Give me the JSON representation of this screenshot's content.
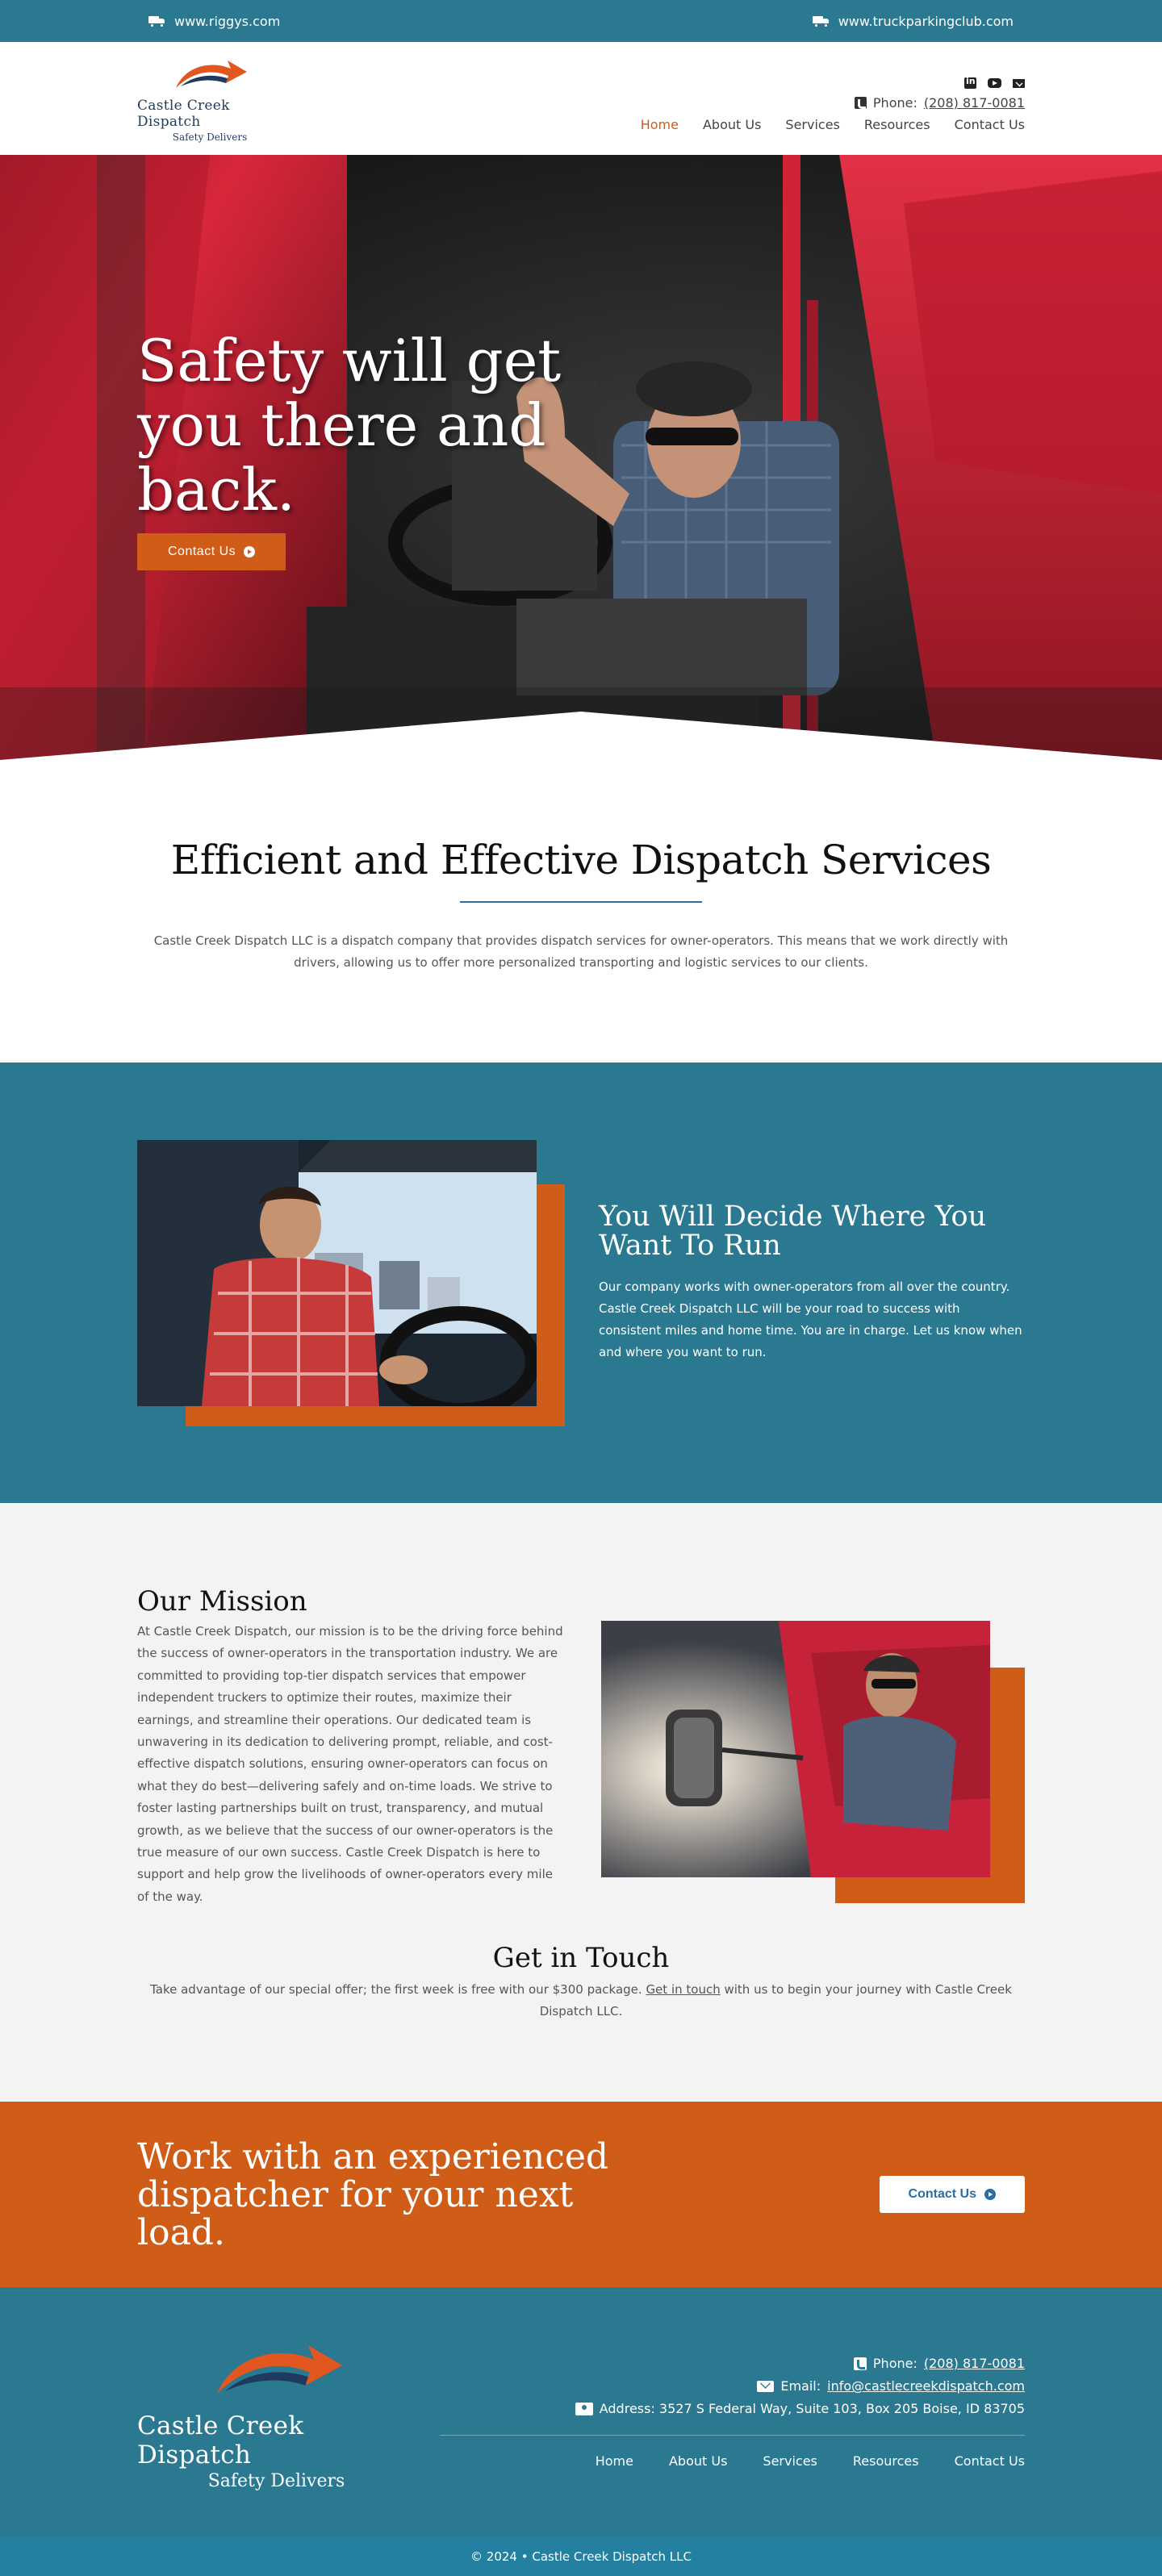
{
  "topbar": {
    "left_link": "www.riggys.com",
    "right_link": "www.truckparkingclub.com"
  },
  "header": {
    "logo_name": "Castle Creek Dispatch",
    "logo_tagline": "Safety Delivers",
    "social_icons": [
      "linkedin-icon",
      "youtube-icon",
      "mail-icon"
    ],
    "phone_label": "Phone:",
    "phone_number": "(208) 817-0081",
    "nav": [
      "Home",
      "About Us",
      "Services",
      "Resources",
      "Contact Us"
    ],
    "active_nav": "Home"
  },
  "hero": {
    "title": "Safety will get you there and back.",
    "button_label": "Contact Us"
  },
  "services": {
    "title": "Efficient and Effective Dispatch Services",
    "body": "Castle Creek Dispatch LLC is a dispatch company that provides dispatch services for owner-operators. This means that we work directly with drivers, allowing us to offer more personalized transporting and logistic services to our clients."
  },
  "decide": {
    "title": "You Will Decide Where You Want To Run",
    "body": "Our company works with owner-operators from all over the country. Castle Creek Dispatch LLC will be your road to success with consistent miles and home time. You are in charge. Let us know when and where you want to run."
  },
  "mission": {
    "title": "Our Mission",
    "body": "At Castle Creek Dispatch, our mission is to be the driving force behind the success of owner-operators in the transportation industry. We are committed to providing top-tier dispatch services that empower independent truckers to optimize their routes, maximize their earnings, and streamline their operations. Our dedicated team is unwavering in its dedication to delivering prompt, reliable, and cost-effective dispatch solutions, ensuring owner-operators can focus on what they do best—delivering safely and on-time loads. We strive to foster lasting partnerships built on trust, transparency, and mutual growth, as we believe that the success of our owner-operators is the true measure of our own success. Castle Creek Dispatch is here to support and help grow the livelihoods of owner-operators every mile of the way."
  },
  "touch": {
    "title": "Get in Touch",
    "body_before": "Take advantage of our special offer; the first week is free with our $300 package. ",
    "link_text": "Get in touch",
    "body_after": " with us to begin your journey with Castle Creek Dispatch LLC."
  },
  "cta": {
    "title": "Work with an experienced dispatcher for your next load.",
    "button_label": "Contact Us"
  },
  "footer": {
    "logo_name": "Castle Creek Dispatch",
    "logo_tagline": "Safety Delivers",
    "phone_label": "Phone:",
    "phone_number": "(208) 817-0081",
    "email_label": "Email:",
    "email": "info@castlecreekdispatch.com",
    "address": "Address: 3527 S Federal Way, Suite 103, Box 205 Boise, ID 83705",
    "nav": [
      "Home",
      "About Us",
      "Services",
      "Resources",
      "Contact Us"
    ],
    "copyright": "© 2024 • Castle Creek Dispatch LLC"
  },
  "colors": {
    "teal": "#2b7891",
    "orange": "#cf5c17",
    "navy": "#1e3a5f",
    "light_gray": "#f3f3f3"
  }
}
